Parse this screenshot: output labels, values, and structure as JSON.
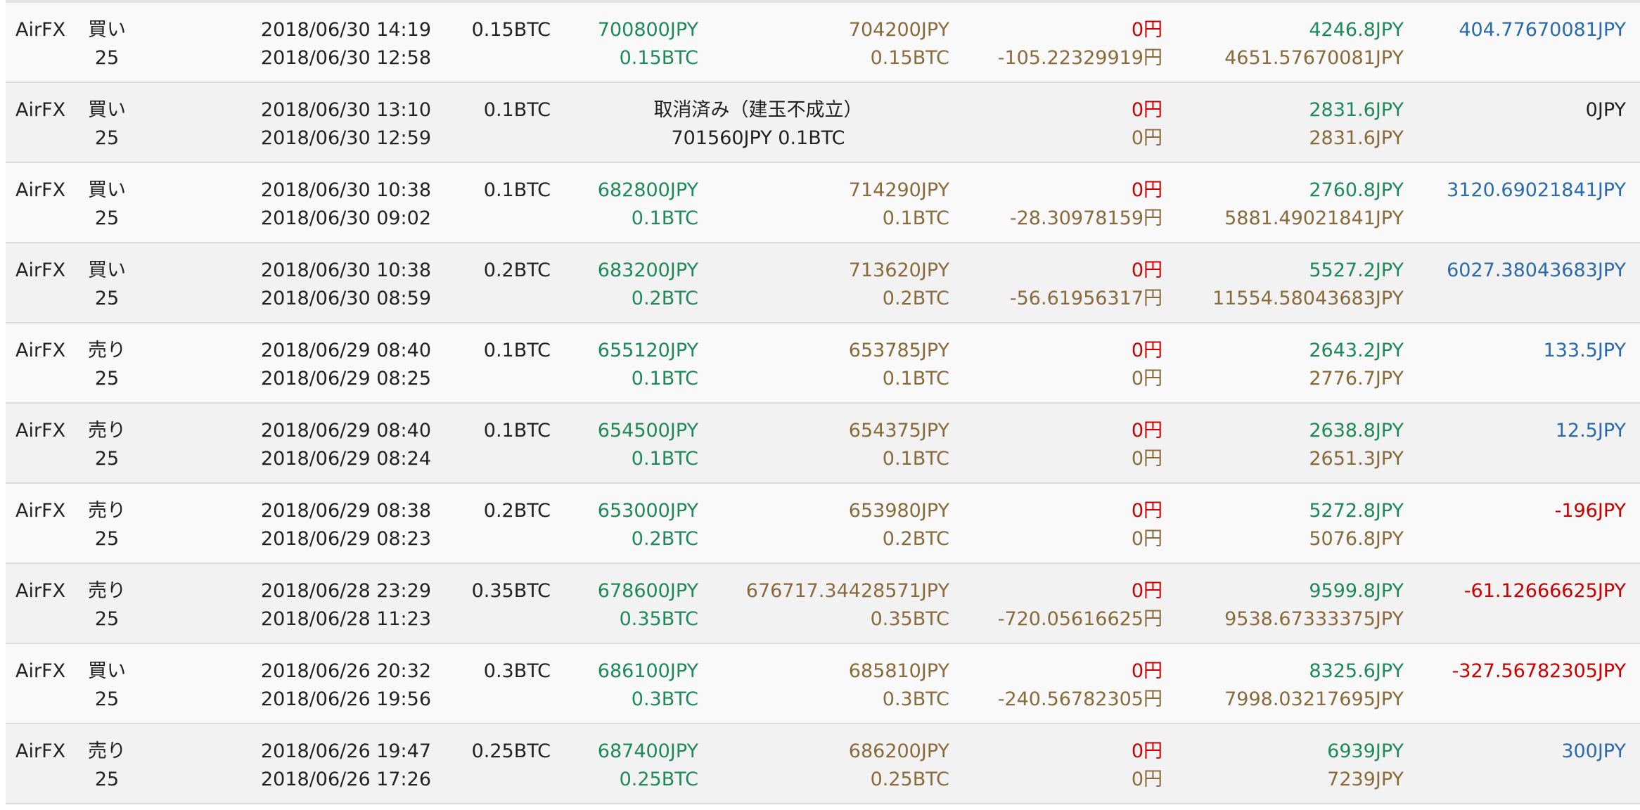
{
  "colors": {
    "positive_fill": "#1e8a5a",
    "close_value": "#8a6a3a",
    "fee": "#cc0000",
    "profit_positive": "#2a6aae",
    "profit_negative": "#cc0000"
  },
  "rows": [
    {
      "market": "AirFX",
      "side": "買い",
      "leverage": "25",
      "close_time": "2018/06/30 14:19",
      "open_time": "2018/06/30 12:58",
      "amount": "0.15BTC",
      "open_price": "700800JPY",
      "open_amount": "0.15BTC",
      "close_price": "704200JPY",
      "close_amount": "0.15BTC",
      "fee": "0円",
      "swap": "-105.22329919円",
      "margin": "4246.8JPY",
      "total": "4651.57670081JPY",
      "profit": "404.77670081JPY",
      "profit_color": "blue"
    },
    {
      "market": "AirFX",
      "side": "買い",
      "leverage": "25",
      "close_time": "2018/06/30 13:10",
      "open_time": "2018/06/30 12:59",
      "amount": "0.1BTC",
      "cancelled": true,
      "cancel_status": "取消済み（建玉不成立）",
      "cancel_order": "701560JPY 0.1BTC",
      "fee": "0円",
      "swap": "0円",
      "margin": "2831.6JPY",
      "total": "2831.6JPY",
      "profit": "0JPY",
      "profit_color": "dark"
    },
    {
      "market": "AirFX",
      "side": "買い",
      "leverage": "25",
      "close_time": "2018/06/30 10:38",
      "open_time": "2018/06/30 09:02",
      "amount": "0.1BTC",
      "open_price": "682800JPY",
      "open_amount": "0.1BTC",
      "close_price": "714290JPY",
      "close_amount": "0.1BTC",
      "fee": "0円",
      "swap": "-28.30978159円",
      "margin": "2760.8JPY",
      "total": "5881.49021841JPY",
      "profit": "3120.69021841JPY",
      "profit_color": "blue"
    },
    {
      "market": "AirFX",
      "side": "買い",
      "leverage": "25",
      "close_time": "2018/06/30 10:38",
      "open_time": "2018/06/30 08:59",
      "amount": "0.2BTC",
      "open_price": "683200JPY",
      "open_amount": "0.2BTC",
      "close_price": "713620JPY",
      "close_amount": "0.2BTC",
      "fee": "0円",
      "swap": "-56.61956317円",
      "margin": "5527.2JPY",
      "total": "11554.58043683JPY",
      "profit": "6027.38043683JPY",
      "profit_color": "blue"
    },
    {
      "market": "AirFX",
      "side": "売り",
      "leverage": "25",
      "close_time": "2018/06/29 08:40",
      "open_time": "2018/06/29 08:25",
      "amount": "0.1BTC",
      "open_price": "655120JPY",
      "open_amount": "0.1BTC",
      "close_price": "653785JPY",
      "close_amount": "0.1BTC",
      "fee": "0円",
      "swap": "0円",
      "margin": "2643.2JPY",
      "total": "2776.7JPY",
      "profit": "133.5JPY",
      "profit_color": "blue"
    },
    {
      "market": "AirFX",
      "side": "売り",
      "leverage": "25",
      "close_time": "2018/06/29 08:40",
      "open_time": "2018/06/29 08:24",
      "amount": "0.1BTC",
      "open_price": "654500JPY",
      "open_amount": "0.1BTC",
      "close_price": "654375JPY",
      "close_amount": "0.1BTC",
      "fee": "0円",
      "swap": "0円",
      "margin": "2638.8JPY",
      "total": "2651.3JPY",
      "profit": "12.5JPY",
      "profit_color": "blue"
    },
    {
      "market": "AirFX",
      "side": "売り",
      "leverage": "25",
      "close_time": "2018/06/29 08:38",
      "open_time": "2018/06/29 08:23",
      "amount": "0.2BTC",
      "open_price": "653000JPY",
      "open_amount": "0.2BTC",
      "close_price": "653980JPY",
      "close_amount": "0.2BTC",
      "fee": "0円",
      "swap": "0円",
      "margin": "5272.8JPY",
      "total": "5076.8JPY",
      "profit": "-196JPY",
      "profit_color": "red"
    },
    {
      "market": "AirFX",
      "side": "売り",
      "leverage": "25",
      "close_time": "2018/06/28 23:29",
      "open_time": "2018/06/28 11:23",
      "amount": "0.35BTC",
      "open_price": "678600JPY",
      "open_amount": "0.35BTC",
      "close_price": "676717.34428571JPY",
      "close_amount": "0.35BTC",
      "fee": "0円",
      "swap": "-720.05616625円",
      "margin": "9599.8JPY",
      "total": "9538.67333375JPY",
      "profit": "-61.12666625JPY",
      "profit_color": "red"
    },
    {
      "market": "AirFX",
      "side": "買い",
      "leverage": "25",
      "close_time": "2018/06/26 20:32",
      "open_time": "2018/06/26 19:56",
      "amount": "0.3BTC",
      "open_price": "686100JPY",
      "open_amount": "0.3BTC",
      "close_price": "685810JPY",
      "close_amount": "0.3BTC",
      "fee": "0円",
      "swap": "-240.56782305円",
      "margin": "8325.6JPY",
      "total": "7998.03217695JPY",
      "profit": "-327.56782305JPY",
      "profit_color": "red"
    },
    {
      "market": "AirFX",
      "side": "売り",
      "leverage": "25",
      "close_time": "2018/06/26 19:47",
      "open_time": "2018/06/26 17:26",
      "amount": "0.25BTC",
      "open_price": "687400JPY",
      "open_amount": "0.25BTC",
      "close_price": "686200JPY",
      "close_amount": "0.25BTC",
      "fee": "0円",
      "swap": "0円",
      "margin": "6939JPY",
      "total": "7239JPY",
      "profit": "300JPY",
      "profit_color": "blue"
    }
  ]
}
